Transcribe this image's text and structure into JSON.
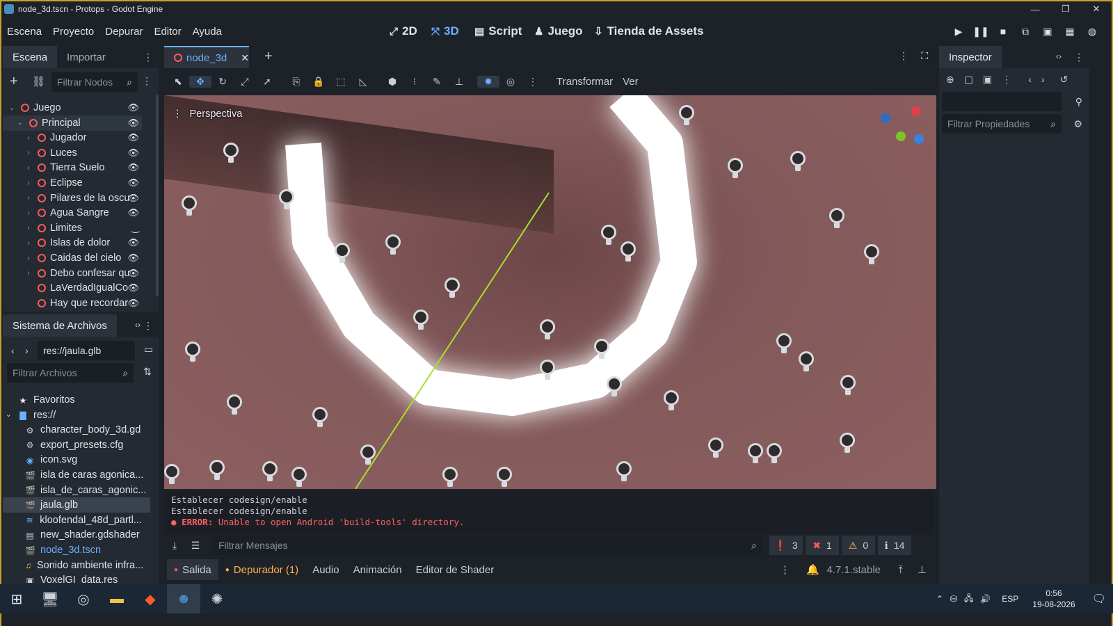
{
  "window": {
    "title": "node_3d.tscn - Protops - Godot Engine"
  },
  "menu": [
    "Escena",
    "Proyecto",
    "Depurar",
    "Editor",
    "Ayuda"
  ],
  "workspaces": [
    {
      "label": "2D",
      "icon": "2d-icon"
    },
    {
      "label": "3D",
      "icon": "3d-icon",
      "active": true
    },
    {
      "label": "Script",
      "icon": "script-icon"
    },
    {
      "label": "Juego",
      "icon": "game-icon"
    },
    {
      "label": "Tienda de Assets",
      "icon": "assetlib-icon"
    }
  ],
  "scene_dock": {
    "tabs": [
      "Escena",
      "Importar"
    ],
    "filter_placeholder": "Filtrar Nodos",
    "tree": [
      {
        "label": "Juego",
        "level": 0,
        "expanded": true
      },
      {
        "label": "Principal",
        "level": 1,
        "expanded": true,
        "selected": true
      },
      {
        "label": "Jugador",
        "level": 2
      },
      {
        "label": "Luces",
        "level": 2
      },
      {
        "label": "Tierra Suelo",
        "level": 2
      },
      {
        "label": "Eclipse",
        "level": 2
      },
      {
        "label": "Pilares de la oscu",
        "level": 2
      },
      {
        "label": "Agua Sangre",
        "level": 2
      },
      {
        "label": "Limites",
        "level": 2,
        "hidden": true
      },
      {
        "label": "Islas de dolor",
        "level": 2
      },
      {
        "label": "Caidas del cielo",
        "level": 2
      },
      {
        "label": "Debo confesar qu",
        "level": 2
      },
      {
        "label": "LaVerdadIgualCo",
        "level": 2,
        "no_arrow": true
      },
      {
        "label": "Hay que recordar",
        "level": 2,
        "no_arrow": true
      }
    ]
  },
  "filesystem": {
    "title": "Sistema de Archivos",
    "path": "res://jaula.glb",
    "filter_placeholder": "Filtrar Archivos",
    "items": [
      {
        "label": "Favoritos",
        "icon": "star-icon",
        "level": 0
      },
      {
        "label": "res://",
        "icon": "folder-icon",
        "level": 0,
        "expanded": true
      },
      {
        "label": "character_body_3d.gd",
        "icon": "gear-icon",
        "level": 1
      },
      {
        "label": "export_presets.cfg",
        "icon": "settings-icon",
        "level": 1
      },
      {
        "label": "icon.svg",
        "icon": "image-icon",
        "level": 1
      },
      {
        "label": "isla de caras agonica...",
        "icon": "scene-icon",
        "level": 1
      },
      {
        "label": "isla_de_caras_agonic...",
        "icon": "scene-icon",
        "level": 1
      },
      {
        "label": "jaula.glb",
        "icon": "scene-icon",
        "level": 1,
        "selected": true
      },
      {
        "label": "kloofendal_48d_partl...",
        "icon": "hdr-icon",
        "level": 1
      },
      {
        "label": "new_shader.gdshader",
        "icon": "shader-icon",
        "level": 1
      },
      {
        "label": "node_3d.tscn",
        "icon": "scene-icon",
        "level": 1,
        "highlight": true
      },
      {
        "label": "Sonido ambiente infra...",
        "icon": "audio-icon",
        "level": 1
      },
      {
        "label": "VoxelGI_data.res",
        "icon": "resource-icon",
        "level": 1
      }
    ]
  },
  "editor": {
    "tab": "node_3d",
    "toolbar_text": [
      "Transformar",
      "Ver"
    ],
    "viewport_label": "Perspectiva"
  },
  "output": {
    "lines": [
      "Establecer codesign/enable",
      "Establecer codesign/enable"
    ],
    "error_prefix": "ERROR:",
    "error_text": "Unable to open Android 'build-tools' directory.",
    "filter_placeholder": "Filtrar Mensajes",
    "counts": {
      "messages": "3",
      "errors": "1",
      "warnings": "0",
      "info": "14"
    }
  },
  "bottom_tabs": [
    "Salida",
    "Depurador (1)",
    "Audio",
    "Animación",
    "Editor de Shader"
  ],
  "version": "4.7.1.stable",
  "inspector": {
    "title": "Inspector",
    "filter_placeholder": "Filtrar Propiedades"
  },
  "taskbar": {
    "lang": "ESP",
    "time": "0:56",
    "date": "19-08-2026"
  },
  "colors": {
    "accent": "#6bb1ff",
    "error": "#ff6060",
    "node": "#ff5a5a"
  }
}
